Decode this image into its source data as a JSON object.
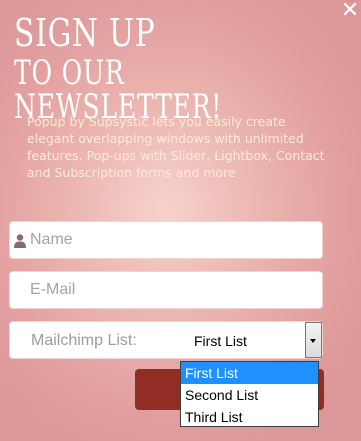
{
  "popup": {
    "close_symbol": "✕",
    "headline_line1": "SIGN UP",
    "headline_line2": "TO OUR NEWSLETTER!",
    "description": "Popup by Supsystic lets you easily create elegant overlapping windows with unlimited features. Pop-ups with Slider, Lightbox, Contact and Subscription forms and more"
  },
  "form": {
    "name_placeholder": "Name",
    "email_placeholder": "E-Mail",
    "list_label": "Mailchimp List:",
    "list_selected": "First List",
    "list_options": [
      "First List",
      "Second List",
      "Third List"
    ],
    "submit_label": ""
  },
  "colors": {
    "background": "#e3a9a9",
    "button": "#922d26",
    "description_text": "#fcebd8",
    "highlight": "#1e90ff"
  },
  "icons": {
    "close": "close-icon",
    "user": "user-icon",
    "dropdown": "chevron-down-icon"
  }
}
